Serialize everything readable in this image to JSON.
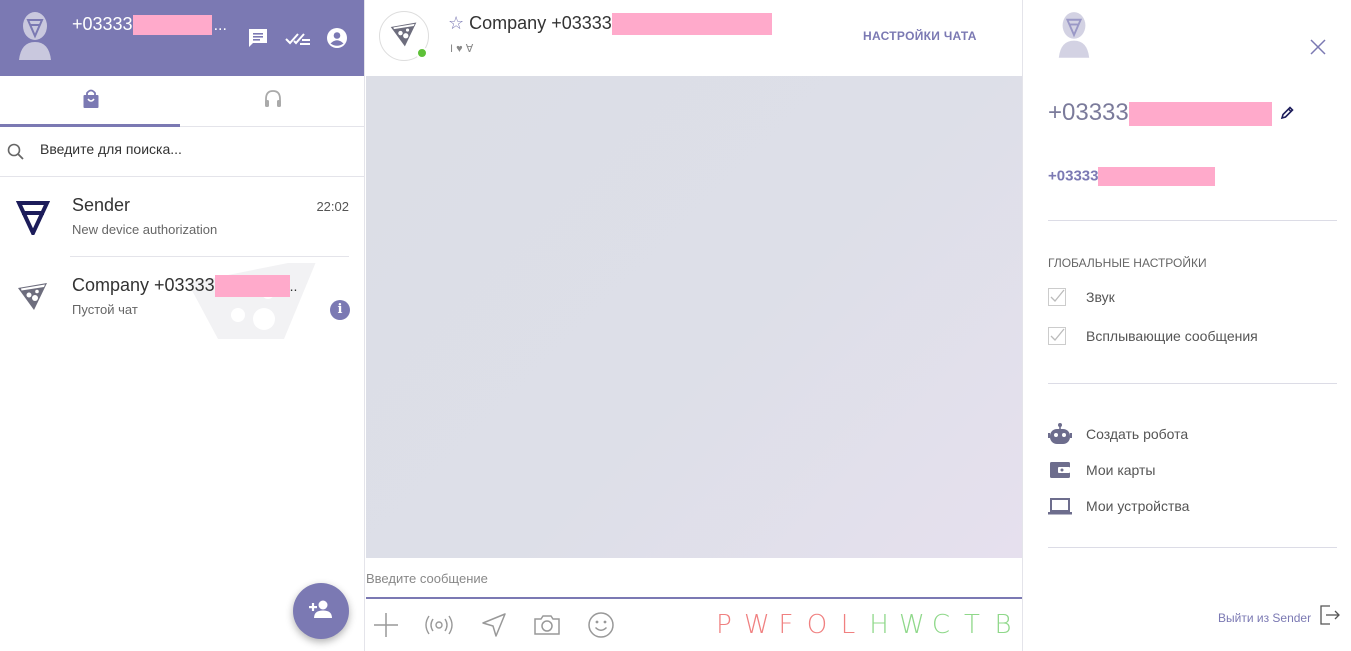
{
  "colors": {
    "brand": "#7b79b3",
    "online": "#5ec138",
    "redaction": "#ffaacb"
  },
  "profile": {
    "phone_prefix": "+03333",
    "ellipsis": "..."
  },
  "header_icons": [
    "chat-icon",
    "read-all-icon",
    "account-icon"
  ],
  "tabs": [
    {
      "name": "chats",
      "icon": "shopping-bag-icon",
      "active": true
    },
    {
      "name": "support",
      "icon": "headset-icon",
      "active": false
    }
  ],
  "search": {
    "placeholder": "Введите для поиска..."
  },
  "chat_list": [
    {
      "name": "Sender",
      "subtitle": "New device authorization",
      "time": "22:02",
      "icon": "sender-logo-icon"
    },
    {
      "name": "Company +03333",
      "name_ellipsis": "..",
      "subtitle": "Пустой чат",
      "time": "",
      "icon": "pizza-icon",
      "badge": "i"
    }
  ],
  "fab": {
    "icon": "add-contact-icon"
  },
  "chat": {
    "star": "☆",
    "title": "Company +03333",
    "status": "I ♥ ∀",
    "settings_label": "НАСТРОЙКИ ЧАТА",
    "input_placeholder": "Введите сообщение",
    "tools": [
      "plus-icon",
      "broadcast-icon",
      "location-icon",
      "camera-icon",
      "emoji-icon"
    ],
    "letters": [
      {
        "ch": "P",
        "color": "#f08080"
      },
      {
        "ch": "W",
        "color": "#f08080"
      },
      {
        "ch": "F",
        "color": "#f08080"
      },
      {
        "ch": "O",
        "color": "#f08080"
      },
      {
        "ch": "L",
        "color": "#f08080"
      },
      {
        "ch": "H",
        "color": "#8fd88a"
      },
      {
        "ch": "W",
        "color": "#8fd88a"
      },
      {
        "ch": "C",
        "color": "#8fd88a"
      },
      {
        "ch": "T",
        "color": "#8fd88a"
      },
      {
        "ch": "B",
        "color": "#8fd88a"
      }
    ]
  },
  "details": {
    "phone": "+03333",
    "phone_secondary": "+03333",
    "global_settings_label": "ГЛОБАЛЬНЫЕ НАСТРОЙКИ",
    "checks": [
      {
        "label": "Звук",
        "checked": true
      },
      {
        "label": "Всплывающие сообщения",
        "checked": true
      }
    ],
    "menu": [
      {
        "label": "Создать робота",
        "icon": "robot-icon"
      },
      {
        "label": "Мои карты",
        "icon": "wallet-icon"
      },
      {
        "label": "Мои устройства",
        "icon": "laptop-icon"
      }
    ],
    "logout_label": "Выйти из Sender"
  }
}
